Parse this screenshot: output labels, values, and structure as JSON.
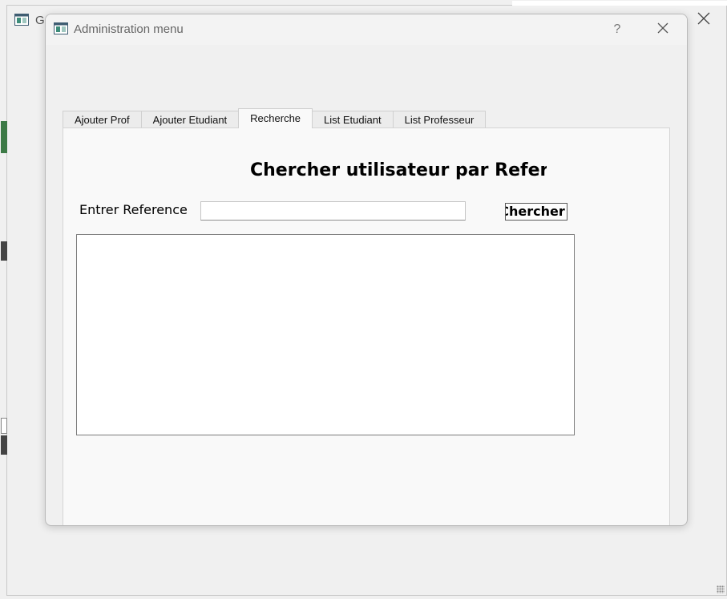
{
  "background_window": {
    "title": "Ge",
    "app_icon": "app-window-icon",
    "close_icon": "close-icon"
  },
  "dialog": {
    "title": "Administration menu",
    "app_icon": "app-window-icon",
    "help_label": "?",
    "close_icon": "close-icon"
  },
  "tabs": [
    {
      "label": "Ajouter Prof",
      "active": false
    },
    {
      "label": "Ajouter Etudiant",
      "active": false
    },
    {
      "label": "Recherche",
      "active": true
    },
    {
      "label": "List Etudiant",
      "active": false
    },
    {
      "label": "List Professeur",
      "active": false
    }
  ],
  "search_panel": {
    "heading": "Chercher utilisateur par Referei",
    "reference_label": "Entrer Reference",
    "reference_value": "",
    "search_button_label": "Chercher"
  },
  "colors": {
    "window_bg": "#f0f0f0",
    "panel_bg": "#f9f9f9",
    "accent_green": "#3c7a46"
  }
}
